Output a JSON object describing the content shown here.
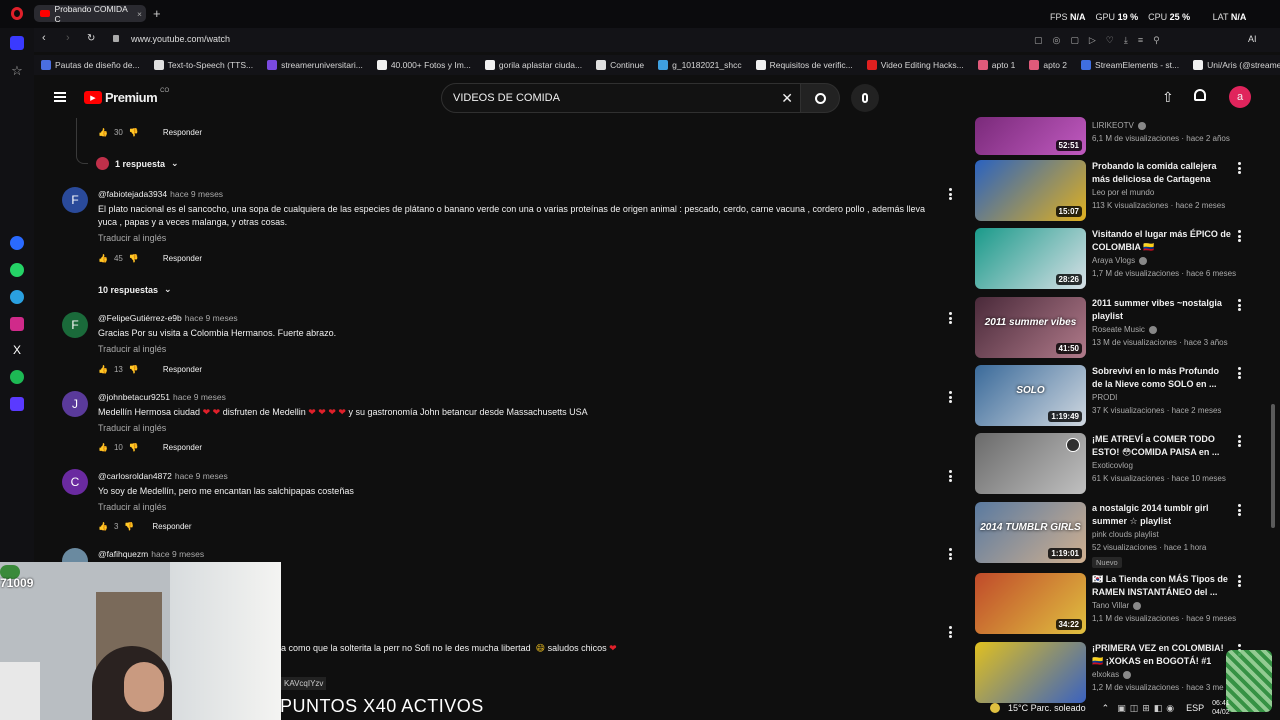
{
  "browser": {
    "tab_title": "Probando COMIDA C",
    "url": "www.youtube.com/watch",
    "stats": {
      "fps_label": "FPS",
      "fps": "N/A",
      "gpu_label": "GPU",
      "gpu": "19 %",
      "cpu_label": "CPU",
      "cpu": "25 %",
      "lat_label": "LAT",
      "lat": "N/A"
    },
    "ai_label": "AI",
    "bookmarks": [
      {
        "label": "Pautas de diseño de...",
        "color": "#4a6ee0"
      },
      {
        "label": "Text-to-Speech (TTS...",
        "color": "#e0e0e0"
      },
      {
        "label": "streameruniversitari...",
        "color": "#7a4ae0"
      },
      {
        "label": "40.000+ Fotos y Im...",
        "color": "#f1f1f1"
      },
      {
        "label": "gorila aplastar ciuda...",
        "color": "#f1f1f1"
      },
      {
        "label": "Continue",
        "color": "#e0e0e0"
      },
      {
        "label": "g_10182021_shcc",
        "color": "#3fa0e0"
      },
      {
        "label": "Requisitos de verific...",
        "color": "#f1f1f1"
      },
      {
        "label": "Video Editing Hacks...",
        "color": "#e02020"
      },
      {
        "label": "apto 1",
        "color": "#e05a7a"
      },
      {
        "label": "apto 2",
        "color": "#e05a7a"
      },
      {
        "label": "StreamElements - st...",
        "color": "#3f6ee0"
      },
      {
        "label": "Uni/Aris (@streame...",
        "color": "#f1f1f1"
      }
    ]
  },
  "youtube": {
    "logo_text": "Premium",
    "logo_sup": "CO",
    "search_value": "VIDEOS DE COMIDA",
    "avatar_letter": "a"
  },
  "comments": {
    "top_likes": "30",
    "reply_label": "Responder",
    "one_reply": "1 respuesta",
    "translate_label": "Traducir al inglés",
    "items": [
      {
        "letter": "F",
        "author": "@fabiotejada3934",
        "time": "hace 9 meses",
        "line1": "El plato nacional es el sancocho, una sopa de cualquiera de las especies de plátano o banano verde con una o varias proteínas de origen animal : pescado, cerdo, carne vacuna , cordero pollo , además lleva",
        "line2": "yuca , papas y a veces malanga, y otras cosas.",
        "likes": "45",
        "replies": "10 respuestas"
      },
      {
        "letter": "F",
        "author": "@FelipeGutiérrez-e9b",
        "time": "hace 9 meses",
        "line1": "Gracias Por su visita a Colombia Hermanos. Fuerte abrazo.",
        "likes": "13"
      },
      {
        "letter": "J",
        "author": "@johnbetacur9251",
        "time": "hace 9 meses",
        "line1a": "Medellín Hermosa ciudad",
        "line1b": "disfruten de Medellin",
        "line1c": "y su gastronomía John betancur desde Massachusetts USA",
        "likes": "10"
      },
      {
        "letter": "C",
        "author": "@carlosroldan4872",
        "time": "hace 9 meses",
        "line1": "Yo soy de Medellín, pero me encantan las salchipapas costeñas",
        "likes": "3"
      },
      {
        "author": "@fafihquezm",
        "time": "hace 9 meses",
        "line1": "a como que la solterita la perr no Sofi no le des mucha libertad",
        "line1b": "saludos chicos"
      }
    ]
  },
  "recommendations": [
    {
      "title1": "",
      "title2": "",
      "channel": "LIRIKEOTV",
      "meta": "6,1 M de visualizaciones · hace 2 años",
      "duration": "52:51",
      "colors": [
        "#7a2a7a",
        "#c05ac0"
      ]
    },
    {
      "title1": "Probando la comida callejera",
      "title2": "más deliciosa de Cartagena",
      "channel": "Leo por el mundo",
      "meta": "113 K visualizaciones · hace 2 meses",
      "duration": "15:07",
      "colors": [
        "#2a62c0",
        "#e0b020"
      ]
    },
    {
      "title1": "Visitando el lugar más ÉPICO de",
      "title2": "COLOMBIA 🇨🇴",
      "channel": "Araya Vlogs",
      "meta": "1,7 M de visualizaciones · hace 6 meses",
      "duration": "28:26",
      "colors": [
        "#1a9a8a",
        "#d8e0e6"
      ]
    },
    {
      "title1": "2011 summer vibes ~nostalgia",
      "title2": "playlist",
      "channel": "Roseate Music",
      "meta": "13 M de visualizaciones · hace 3 años",
      "duration": "41:50",
      "colors": [
        "#4a2a3a",
        "#b07a8a"
      ],
      "overlay": "2011 summer vibes"
    },
    {
      "title1": "Sobreviví en lo más Profundo",
      "title2": "de la Nieve como SOLO en ...",
      "channel": "PRODI",
      "meta": "37 K visualizaciones · hace 2 meses",
      "duration": "1:19:49",
      "colors": [
        "#3a6a9a",
        "#d0d8e0"
      ],
      "overlay": "SOLO"
    },
    {
      "title1": "¡ME ATREVÍ a COMER TODO",
      "title2": "ESTO! 😳COMIDA PAISA en ...",
      "channel": "Exoticovlog",
      "meta": "61 K visualizaciones · hace 10 meses",
      "duration": "",
      "colors": [
        "#6a6a6a",
        "#c0c0c0"
      ]
    },
    {
      "title1": "a nostalgic 2014 tumblr girl",
      "title2": "summer ☆ playlist",
      "channel": "pink clouds playlist",
      "meta": "52 visualizaciones · hace 1 hora",
      "duration": "1:19:01",
      "colors": [
        "#5a7aa0",
        "#d0b090"
      ],
      "overlay": "2014 TUMBLR GIRLS",
      "badge": "Nuevo"
    },
    {
      "title1": "🇰🇷 La Tienda con MÁS Tipos de",
      "title2": "RAMEN INSTANTÁNEO del ...",
      "channel": "Tano Villar",
      "meta": "1,1 M de visualizaciones · hace 9 meses",
      "duration": "34:22",
      "colors": [
        "#c04a2a",
        "#e0c040"
      ]
    },
    {
      "title1": "¡PRIMERA VEZ en COLOMBIA!",
      "title2": "🇨🇴 ¡XOKAS en BOGOTÁ! #1",
      "channel": "elxokas",
      "meta": "1,2 M de visualizaciones · hace 3 me",
      "duration": "",
      "colors": [
        "#e0c020",
        "#3a62c0"
      ]
    }
  ],
  "overlays": {
    "webcam_number": "71009",
    "small_id": "KAVcqIYzv",
    "puntos": "PUNTOS X40 ACTIVOS",
    "weather": "15°C  Parc. soleado",
    "lang": "ESP",
    "time": "06:41",
    "date": "04/02"
  }
}
